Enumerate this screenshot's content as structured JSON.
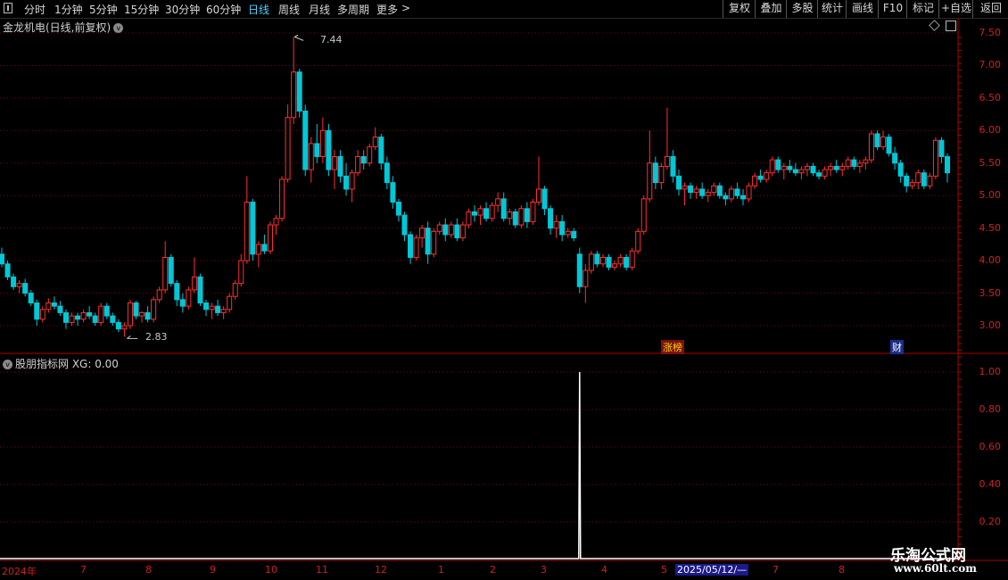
{
  "toolbar": {
    "left_items": [
      "分时",
      "1分钟",
      "5分钟",
      "15分钟",
      "30分钟",
      "60分钟",
      "日线",
      "周线",
      "月线",
      "多周期",
      "更多"
    ],
    "active": "日线",
    "right_items": [
      "复权",
      "叠加",
      "多股",
      "统计",
      "画线",
      "F10",
      "标记",
      "+自选",
      "返回"
    ]
  },
  "main_title": "金龙机电(日线,前复权)",
  "sub_title": "股朋指标网 XG: 0.00",
  "price_axis": [
    "7.50",
    "7.00",
    "6.50",
    "6.00",
    "5.50",
    "5.00",
    "4.50",
    "4.00",
    "3.50",
    "3.00"
  ],
  "indicator_axis": [
    "1.00",
    "0.80",
    "0.60",
    "0.40",
    "0.20"
  ],
  "high_label": "7.44",
  "low_label": "2.83",
  "tags": {
    "zhangbang": "涨榜",
    "cai": "财"
  },
  "dates": [
    "2024年",
    "7",
    "8",
    "9",
    "10",
    "11",
    "12",
    "1",
    "2",
    "3",
    "4",
    "5",
    "2025/05/12/—",
    "7",
    "8"
  ],
  "watermark": {
    "line1": "乐淘公式网",
    "line2": "www.60lt.com"
  },
  "chart_data": {
    "type": "candlestick",
    "title": "金龙机电(日线,前复权)",
    "ylim": [
      2.7,
      7.6
    ],
    "ohlc": [
      [
        4.1,
        4.2,
        3.9,
        3.95
      ],
      [
        3.95,
        4.0,
        3.7,
        3.75
      ],
      [
        3.75,
        3.8,
        3.55,
        3.6
      ],
      [
        3.6,
        3.7,
        3.5,
        3.65
      ],
      [
        3.65,
        3.72,
        3.45,
        3.5
      ],
      [
        3.5,
        3.55,
        3.3,
        3.35
      ],
      [
        3.35,
        3.4,
        3.0,
        3.1
      ],
      [
        3.1,
        3.3,
        3.05,
        3.25
      ],
      [
        3.25,
        3.42,
        3.2,
        3.35
      ],
      [
        3.35,
        3.45,
        3.25,
        3.3
      ],
      [
        3.3,
        3.38,
        3.15,
        3.2
      ],
      [
        3.2,
        3.25,
        2.95,
        3.05
      ],
      [
        3.05,
        3.2,
        3.0,
        3.15
      ],
      [
        3.15,
        3.2,
        3.0,
        3.1
      ],
      [
        3.1,
        3.25,
        3.05,
        3.2
      ],
      [
        3.2,
        3.3,
        3.1,
        3.15
      ],
      [
        3.15,
        3.2,
        3.0,
        3.05
      ],
      [
        3.05,
        3.35,
        3.0,
        3.3
      ],
      [
        3.3,
        3.35,
        3.1,
        3.15
      ],
      [
        3.15,
        3.2,
        3.0,
        3.05
      ],
      [
        3.05,
        3.1,
        2.9,
        2.95
      ],
      [
        2.95,
        3.05,
        2.83,
        3.0
      ],
      [
        3.0,
        3.4,
        2.95,
        3.35
      ],
      [
        3.35,
        3.38,
        3.1,
        3.15
      ],
      [
        3.15,
        3.22,
        3.05,
        3.2
      ],
      [
        3.2,
        3.3,
        3.05,
        3.1
      ],
      [
        3.1,
        3.45,
        3.05,
        3.4
      ],
      [
        3.4,
        3.6,
        3.35,
        3.55
      ],
      [
        3.55,
        4.3,
        3.5,
        4.05
      ],
      [
        4.05,
        4.1,
        3.6,
        3.65
      ],
      [
        3.65,
        3.7,
        3.3,
        3.4
      ],
      [
        3.4,
        3.5,
        3.2,
        3.3
      ],
      [
        3.3,
        3.6,
        3.25,
        3.55
      ],
      [
        3.55,
        4.05,
        3.5,
        3.75
      ],
      [
        3.75,
        3.8,
        3.3,
        3.35
      ],
      [
        3.35,
        3.4,
        3.15,
        3.25
      ],
      [
        3.25,
        3.35,
        3.1,
        3.3
      ],
      [
        3.3,
        3.4,
        3.15,
        3.2
      ],
      [
        3.2,
        3.3,
        3.1,
        3.25
      ],
      [
        3.25,
        3.5,
        3.2,
        3.45
      ],
      [
        3.45,
        3.7,
        3.4,
        3.65
      ],
      [
        3.65,
        4.1,
        3.6,
        4.0
      ],
      [
        4.0,
        5.3,
        3.95,
        4.9
      ],
      [
        4.9,
        4.95,
        4.0,
        4.1
      ],
      [
        4.1,
        4.3,
        3.9,
        4.25
      ],
      [
        4.25,
        4.4,
        4.1,
        4.15
      ],
      [
        4.15,
        4.6,
        4.1,
        4.55
      ],
      [
        4.55,
        4.7,
        4.4,
        4.65
      ],
      [
        4.65,
        5.3,
        4.6,
        5.25
      ],
      [
        5.25,
        6.4,
        5.2,
        6.2
      ],
      [
        6.2,
        7.44,
        6.1,
        6.9
      ],
      [
        6.9,
        6.95,
        6.2,
        6.3
      ],
      [
        6.3,
        6.4,
        5.3,
        5.4
      ],
      [
        5.4,
        5.9,
        5.2,
        5.8
      ],
      [
        5.8,
        6.1,
        5.5,
        5.6
      ],
      [
        5.6,
        6.2,
        5.5,
        6.0
      ],
      [
        6.0,
        6.1,
        5.3,
        5.4
      ],
      [
        5.4,
        5.7,
        5.1,
        5.6
      ],
      [
        5.6,
        5.7,
        5.2,
        5.3
      ],
      [
        5.3,
        5.5,
        5.0,
        5.1
      ],
      [
        5.1,
        5.4,
        4.9,
        5.35
      ],
      [
        5.35,
        5.7,
        5.3,
        5.6
      ],
      [
        5.6,
        5.7,
        5.4,
        5.5
      ],
      [
        5.5,
        5.8,
        5.45,
        5.75
      ],
      [
        5.75,
        6.05,
        5.7,
        5.9
      ],
      [
        5.9,
        5.95,
        5.4,
        5.5
      ],
      [
        5.5,
        5.6,
        5.1,
        5.2
      ],
      [
        5.2,
        5.3,
        4.8,
        4.9
      ],
      [
        4.9,
        4.95,
        4.6,
        4.7
      ],
      [
        4.7,
        4.75,
        4.3,
        4.4
      ],
      [
        4.4,
        4.45,
        3.95,
        4.05
      ],
      [
        4.05,
        4.4,
        4.0,
        4.35
      ],
      [
        4.35,
        4.55,
        4.2,
        4.5
      ],
      [
        4.5,
        4.6,
        3.95,
        4.1
      ],
      [
        4.1,
        4.5,
        4.05,
        4.45
      ],
      [
        4.45,
        4.6,
        4.4,
        4.55
      ],
      [
        4.55,
        4.65,
        4.3,
        4.4
      ],
      [
        4.4,
        4.6,
        4.35,
        4.55
      ],
      [
        4.55,
        4.65,
        4.3,
        4.35
      ],
      [
        4.35,
        4.6,
        4.3,
        4.55
      ],
      [
        4.55,
        4.8,
        4.5,
        4.75
      ],
      [
        4.75,
        4.85,
        4.6,
        4.7
      ],
      [
        4.7,
        4.85,
        4.55,
        4.8
      ],
      [
        4.8,
        4.9,
        4.6,
        4.65
      ],
      [
        4.65,
        4.9,
        4.6,
        4.85
      ],
      [
        4.85,
        5.05,
        4.75,
        4.95
      ],
      [
        4.95,
        5.05,
        4.6,
        4.65
      ],
      [
        4.65,
        4.8,
        4.55,
        4.75
      ],
      [
        4.75,
        4.8,
        4.5,
        4.55
      ],
      [
        4.55,
        4.85,
        4.5,
        4.8
      ],
      [
        4.8,
        4.9,
        4.5,
        4.6
      ],
      [
        4.6,
        4.95,
        4.55,
        4.9
      ],
      [
        4.9,
        5.6,
        4.85,
        5.1
      ],
      [
        5.1,
        5.15,
        4.7,
        4.8
      ],
      [
        4.8,
        4.85,
        4.4,
        4.5
      ],
      [
        4.5,
        4.7,
        4.35,
        4.6
      ],
      [
        4.6,
        4.7,
        4.3,
        4.4
      ],
      [
        4.4,
        4.5,
        4.35,
        4.45
      ],
      [
        4.45,
        4.5,
        4.3,
        4.35
      ],
      [
        4.1,
        4.2,
        3.5,
        3.6
      ],
      [
        3.6,
        3.95,
        3.35,
        3.85
      ],
      [
        3.85,
        4.15,
        3.8,
        4.1
      ],
      [
        4.1,
        4.15,
        3.9,
        3.95
      ],
      [
        3.95,
        4.1,
        3.9,
        4.05
      ],
      [
        4.05,
        4.1,
        3.85,
        3.9
      ],
      [
        3.9,
        4.0,
        3.85,
        3.95
      ],
      [
        3.95,
        4.1,
        3.9,
        4.05
      ],
      [
        4.05,
        4.1,
        3.85,
        3.9
      ],
      [
        3.9,
        4.2,
        3.85,
        4.15
      ],
      [
        4.15,
        4.5,
        4.1,
        4.45
      ],
      [
        4.45,
        5.0,
        4.4,
        4.95
      ],
      [
        4.95,
        6.0,
        4.9,
        5.5
      ],
      [
        5.5,
        5.6,
        5.1,
        5.2
      ],
      [
        5.2,
        5.5,
        5.1,
        5.45
      ],
      [
        5.45,
        6.35,
        5.4,
        5.6
      ],
      [
        5.6,
        5.7,
        5.2,
        5.3
      ],
      [
        5.3,
        5.4,
        5.0,
        5.1
      ],
      [
        5.1,
        5.2,
        4.85,
        5.15
      ],
      [
        5.15,
        5.2,
        4.95,
        5.05
      ],
      [
        5.05,
        5.15,
        4.95,
        5.1
      ],
      [
        5.1,
        5.2,
        4.95,
        5.0
      ],
      [
        5.0,
        5.1,
        4.9,
        5.05
      ],
      [
        5.05,
        5.2,
        5.0,
        5.15
      ],
      [
        5.15,
        5.2,
        4.95,
        5.0
      ],
      [
        5.0,
        5.05,
        4.85,
        4.95
      ],
      [
        4.95,
        5.15,
        4.9,
        5.1
      ],
      [
        5.1,
        5.2,
        4.95,
        5.0
      ],
      [
        5.0,
        5.1,
        4.85,
        4.95
      ],
      [
        4.95,
        5.2,
        4.9,
        5.15
      ],
      [
        5.15,
        5.35,
        5.1,
        5.3
      ],
      [
        5.3,
        5.4,
        5.2,
        5.25
      ],
      [
        5.25,
        5.4,
        5.2,
        5.35
      ],
      [
        5.35,
        5.6,
        5.3,
        5.55
      ],
      [
        5.55,
        5.6,
        5.35,
        5.4
      ],
      [
        5.4,
        5.5,
        5.25,
        5.45
      ],
      [
        5.45,
        5.55,
        5.35,
        5.4
      ],
      [
        5.4,
        5.5,
        5.3,
        5.35
      ],
      [
        5.35,
        5.45,
        5.25,
        5.4
      ],
      [
        5.4,
        5.5,
        5.3,
        5.45
      ],
      [
        5.45,
        5.5,
        5.3,
        5.35
      ],
      [
        5.35,
        5.4,
        5.25,
        5.3
      ],
      [
        5.3,
        5.45,
        5.25,
        5.4
      ],
      [
        5.4,
        5.5,
        5.3,
        5.45
      ],
      [
        5.45,
        5.55,
        5.35,
        5.4
      ],
      [
        5.4,
        5.5,
        5.3,
        5.45
      ],
      [
        5.45,
        5.6,
        5.4,
        5.55
      ],
      [
        5.55,
        5.6,
        5.4,
        5.45
      ],
      [
        5.45,
        5.55,
        5.35,
        5.5
      ],
      [
        5.5,
        5.6,
        5.4,
        5.55
      ],
      [
        5.55,
        6.0,
        5.5,
        5.95
      ],
      [
        5.95,
        6.0,
        5.7,
        5.75
      ],
      [
        5.75,
        6.0,
        5.7,
        5.9
      ],
      [
        5.9,
        5.95,
        5.6,
        5.65
      ],
      [
        5.65,
        5.75,
        5.4,
        5.5
      ],
      [
        5.5,
        5.55,
        5.2,
        5.3
      ],
      [
        5.3,
        5.35,
        5.05,
        5.15
      ],
      [
        5.15,
        5.25,
        5.1,
        5.2
      ],
      [
        5.2,
        5.4,
        5.1,
        5.35
      ],
      [
        5.35,
        5.4,
        5.1,
        5.15
      ],
      [
        5.15,
        5.35,
        5.1,
        5.3
      ],
      [
        5.3,
        5.9,
        5.25,
        5.85
      ],
      [
        5.85,
        5.9,
        5.5,
        5.6
      ],
      [
        5.6,
        5.65,
        5.2,
        5.35
      ]
    ],
    "indicator": {
      "name": "XG",
      "ylim": [
        0,
        1.05
      ],
      "signal_bar_index": 99,
      "signal_value": 1.0
    }
  }
}
